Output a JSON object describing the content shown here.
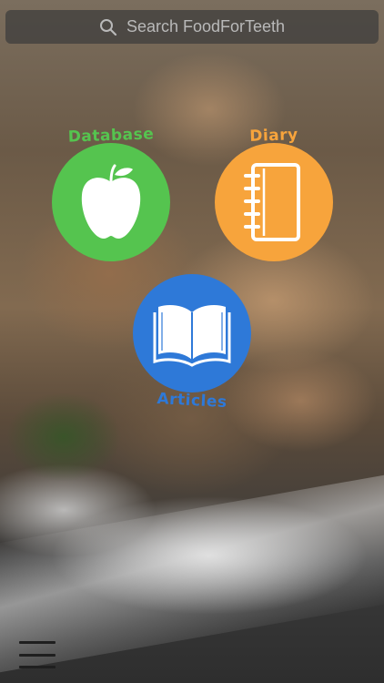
{
  "search": {
    "placeholder": "Search FoodForTeeth",
    "icon": "search-icon"
  },
  "tiles": [
    {
      "label": "Database",
      "icon": "apple-icon",
      "color": "#55c44f"
    },
    {
      "label": "Diary",
      "icon": "notebook-icon",
      "color": "#f7a43c"
    },
    {
      "label": "Articles",
      "icon": "open-book-icon",
      "color": "#2e79d8"
    }
  ],
  "footer": {
    "menu_icon": "hamburger-menu-icon"
  }
}
